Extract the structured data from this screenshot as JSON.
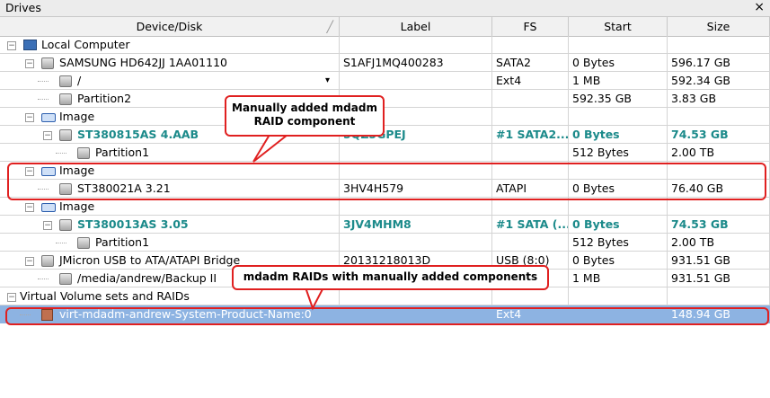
{
  "window": {
    "title": "Drives",
    "close_label": "×"
  },
  "columns": [
    "Device/Disk",
    "Label",
    "FS",
    "Start",
    "Size"
  ],
  "rows": [
    {
      "name": "Local Computer",
      "label": "",
      "fs": "",
      "start": "",
      "size": "",
      "icon": "computer-icon",
      "exp": "−",
      "style": "normal"
    },
    {
      "name": "SAMSUNG HD642JJ 1AA01110",
      "label": "S1AFJ1MQ400283",
      "fs": "SATA2",
      "start": "0 Bytes",
      "size": "596.17 GB",
      "icon": "disk-icon",
      "exp": "−",
      "style": "normal"
    },
    {
      "name": "/",
      "label": "",
      "fs": "Ext4",
      "start": "1 MB",
      "size": "592.34 GB",
      "icon": "partition-icon",
      "exp": "",
      "style": "normal",
      "dropdown": "▾"
    },
    {
      "name": "Partition2",
      "label": "",
      "fs": "",
      "start": "592.35 GB",
      "size": "3.83 GB",
      "icon": "partition-icon",
      "exp": "",
      "style": "normal"
    },
    {
      "name": "Image",
      "label": "",
      "fs": "",
      "start": "",
      "size": "",
      "icon": "image-icon",
      "exp": "−",
      "style": "normal"
    },
    {
      "name": "ST380815AS 4.AAB",
      "label": "5QZ5GPEJ",
      "fs": "#1 SATA2...",
      "start": "0 Bytes",
      "size": "74.53 GB",
      "icon": "disk-icon",
      "exp": "−",
      "style": "teal"
    },
    {
      "name": "Partition1",
      "label": "",
      "fs": "",
      "start": "512 Bytes",
      "size": "2.00 TB",
      "icon": "partition-icon",
      "exp": "",
      "style": "normal"
    },
    {
      "name": "Image",
      "label": "",
      "fs": "",
      "start": "",
      "size": "",
      "icon": "image-icon",
      "exp": "−",
      "style": "normal"
    },
    {
      "name": "ST380021A 3.21",
      "label": "3HV4H579",
      "fs": "ATAPI",
      "start": "0 Bytes",
      "size": "76.40 GB",
      "icon": "disk-icon",
      "exp": "",
      "style": "normal"
    },
    {
      "name": "Image",
      "label": "",
      "fs": "",
      "start": "",
      "size": "",
      "icon": "image-icon",
      "exp": "−",
      "style": "normal"
    },
    {
      "name": "ST380013AS 3.05",
      "label": "3JV4MHM8",
      "fs": "#1 SATA (...",
      "start": "0 Bytes",
      "size": "74.53 GB",
      "icon": "disk-icon",
      "exp": "−",
      "style": "teal"
    },
    {
      "name": "Partition1",
      "label": "",
      "fs": "",
      "start": "512 Bytes",
      "size": "2.00 TB",
      "icon": "partition-icon",
      "exp": "",
      "style": "normal"
    },
    {
      "name": "JMicron USB to ATA/ATAPI Bridge",
      "label": "20131218013D",
      "fs": "USB (8:0)",
      "start": "0 Bytes",
      "size": "931.51 GB",
      "icon": "disk-icon",
      "exp": "−",
      "style": "normal"
    },
    {
      "name": "/media/andrew/Backup II",
      "label": "",
      "fs": "",
      "start": "1 MB",
      "size": "931.51 GB",
      "icon": "partition-icon",
      "exp": "",
      "style": "normal"
    },
    {
      "name": "Virtual Volume sets and RAIDs",
      "label": "",
      "fs": "",
      "start": "",
      "size": "",
      "icon": "",
      "exp": "−",
      "style": "normal"
    },
    {
      "name": "virt-mdadm-andrew-System-Product-Name:0",
      "label": "",
      "fs": "Ext4",
      "start": "",
      "size": "148.94 GB",
      "icon": "raid-volume-icon",
      "exp": "",
      "style": "selected"
    }
  ],
  "annotations": {
    "manual_component": "Manually added mdadm\nRAID component",
    "raids_with_components": "mdadm RAIDs with manually added components"
  },
  "colors": {
    "teal": "#1b8a8a",
    "annotation": "#e02020",
    "selection": "#8db3e2"
  }
}
